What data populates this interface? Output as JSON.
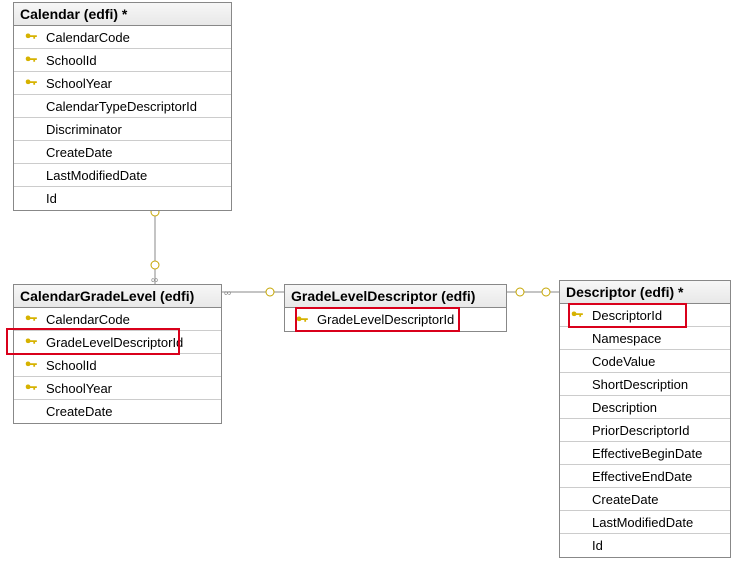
{
  "icons": {
    "key": "🔑"
  },
  "tables": {
    "calendar": {
      "title": "Calendar (edfi) *",
      "columns": [
        {
          "name": "CalendarCode",
          "pk": true
        },
        {
          "name": "SchoolId",
          "pk": true
        },
        {
          "name": "SchoolYear",
          "pk": true
        },
        {
          "name": "CalendarTypeDescriptorId",
          "pk": false
        },
        {
          "name": "Discriminator",
          "pk": false
        },
        {
          "name": "CreateDate",
          "pk": false
        },
        {
          "name": "LastModifiedDate",
          "pk": false
        },
        {
          "name": "Id",
          "pk": false
        }
      ]
    },
    "calendarGradeLevel": {
      "title": "CalendarGradeLevel (edfi)",
      "columns": [
        {
          "name": "CalendarCode",
          "pk": true
        },
        {
          "name": "GradeLevelDescriptorId",
          "pk": true
        },
        {
          "name": "SchoolId",
          "pk": true
        },
        {
          "name": "SchoolYear",
          "pk": true
        },
        {
          "name": "CreateDate",
          "pk": false
        }
      ]
    },
    "gradeLevelDescriptor": {
      "title": "GradeLevelDescriptor (edfi)",
      "columns": [
        {
          "name": "GradeLevelDescriptorId",
          "pk": true
        }
      ]
    },
    "descriptor": {
      "title": "Descriptor (edfi) *",
      "columns": [
        {
          "name": "DescriptorId",
          "pk": true
        },
        {
          "name": "Namespace",
          "pk": false
        },
        {
          "name": "CodeValue",
          "pk": false
        },
        {
          "name": "ShortDescription",
          "pk": false
        },
        {
          "name": "Description",
          "pk": false
        },
        {
          "name": "PriorDescriptorId",
          "pk": false
        },
        {
          "name": "EffectiveBeginDate",
          "pk": false
        },
        {
          "name": "EffectiveEndDate",
          "pk": false
        },
        {
          "name": "CreateDate",
          "pk": false
        },
        {
          "name": "LastModifiedDate",
          "pk": false
        },
        {
          "name": "Id",
          "pk": false
        }
      ]
    }
  },
  "highlighted_columns": [
    "CalendarGradeLevel.GradeLevelDescriptorId",
    "GradeLevelDescriptor.GradeLevelDescriptorId",
    "Descriptor.DescriptorId"
  ],
  "relationships": [
    {
      "from": "Calendar",
      "to": "CalendarGradeLevel",
      "type": "one-to-many"
    },
    {
      "from": "CalendarGradeLevel",
      "to": "GradeLevelDescriptor",
      "type": "many-to-one"
    },
    {
      "from": "GradeLevelDescriptor",
      "to": "Descriptor",
      "type": "one-to-one"
    }
  ]
}
